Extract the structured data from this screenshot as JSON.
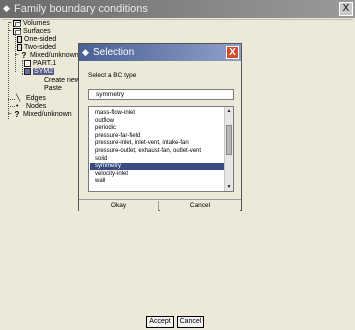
{
  "window": {
    "title": "Family boundary conditions",
    "close_glyph": "X",
    "title_icon": "diamond-icon"
  },
  "tree": {
    "expand_glyph": "−",
    "items": [
      {
        "label": "Volumes"
      },
      {
        "label": "Surfaces"
      },
      {
        "label": "One-sided"
      },
      {
        "label": "Two-sided"
      },
      {
        "label": "Mixed/unknown",
        "glyph": "?"
      },
      {
        "label": "PART.1"
      },
      {
        "label": "SYM2"
      },
      {
        "label": "Create new"
      },
      {
        "label": "Paste"
      },
      {
        "label": "Edges"
      },
      {
        "label": "Nodes"
      },
      {
        "label": "Mixed/unknown",
        "glyph": "?"
      }
    ]
  },
  "buttons": {
    "accept": "Accept",
    "cancel": "Cancel"
  },
  "dialog": {
    "title": "Selection",
    "close_glyph": "X",
    "prompt": "Select a BC type",
    "input_value": "symmetry",
    "options": [
      "mass-flow-inlet",
      "outflow",
      "periodic",
      "pressure-far-field",
      "pressure-inlet, inlet-vent, intake-fan",
      "pressure-outlet, exhaust-fan, outlet-vent",
      "solid",
      "symmetry",
      "velocity-inlet",
      "wall"
    ],
    "selected_option": "symmetry",
    "ok": "Okay",
    "cancel": "Cancel",
    "scroll_up_glyph": "▲",
    "scroll_down_glyph": "▼"
  },
  "colors": {
    "dialog_title": "#4a5f93",
    "selection": "#3a4c82",
    "close_button": "#d84a2a"
  }
}
